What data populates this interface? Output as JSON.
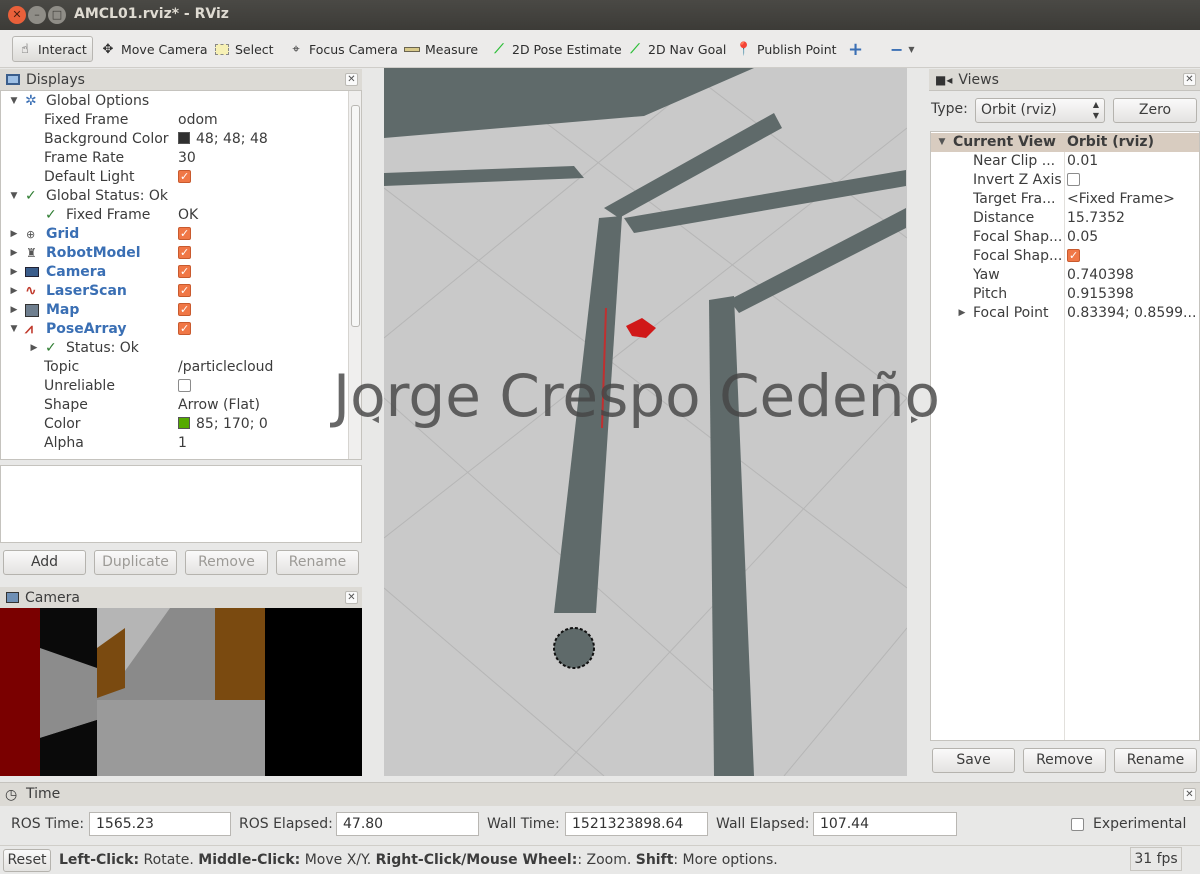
{
  "window": {
    "title": "AMCL01.rviz* - RViz"
  },
  "toolbar": {
    "tools": [
      {
        "label": "Interact",
        "icon": "hand-cursor-icon"
      },
      {
        "label": "Move Camera",
        "icon": "move-camera-icon"
      },
      {
        "label": "Select",
        "icon": "select-icon"
      },
      {
        "label": "Focus Camera",
        "icon": "crosshair-icon"
      },
      {
        "label": "Measure",
        "icon": "ruler-icon"
      },
      {
        "label": "2D Pose Estimate",
        "icon": "green-arrow-icon"
      },
      {
        "label": "2D Nav Goal",
        "icon": "green-arrow-icon"
      },
      {
        "label": "Publish Point",
        "icon": "map-pin-icon"
      }
    ]
  },
  "displays": {
    "title": "Displays",
    "rows": [
      {
        "name": "Global Options",
        "value": ""
      },
      {
        "name": "Fixed Frame",
        "value": "odom"
      },
      {
        "name": "Background Color",
        "value": "48; 48; 48",
        "swatch": "#303030"
      },
      {
        "name": "Frame Rate",
        "value": "30"
      },
      {
        "name": "Default Light",
        "value": ""
      },
      {
        "name": "Global Status: Ok",
        "value": ""
      },
      {
        "name": "Fixed Frame",
        "value": "OK"
      },
      {
        "name": "Grid",
        "value": ""
      },
      {
        "name": "RobotModel",
        "value": ""
      },
      {
        "name": "Camera",
        "value": ""
      },
      {
        "name": "LaserScan",
        "value": ""
      },
      {
        "name": "Map",
        "value": ""
      },
      {
        "name": "PoseArray",
        "value": ""
      },
      {
        "name": "Status: Ok",
        "value": ""
      },
      {
        "name": "Topic",
        "value": "/particlecloud"
      },
      {
        "name": "Unreliable",
        "value": ""
      },
      {
        "name": "Shape",
        "value": "Arrow (Flat)"
      },
      {
        "name": "Color",
        "value": "85; 170; 0",
        "swatch": "#55aa00"
      },
      {
        "name": "Alpha",
        "value": "1"
      }
    ],
    "buttons": {
      "add": "Add",
      "duplicate": "Duplicate",
      "remove": "Remove",
      "rename": "Rename"
    }
  },
  "camera_panel": {
    "title": "Camera"
  },
  "viewport": {
    "watermark": "Jorge Crespo Cedeño"
  },
  "views": {
    "title": "Views",
    "type_label": "Type:",
    "type_value": "Orbit (rviz)",
    "zero_label": "Zero",
    "header": {
      "name": "Current View",
      "value": "Orbit (rviz)"
    },
    "rows": [
      {
        "name": "Near Clip ...",
        "value": "0.01"
      },
      {
        "name": "Invert Z Axis",
        "value": ""
      },
      {
        "name": "Target Fra...",
        "value": "<Fixed Frame>"
      },
      {
        "name": "Distance",
        "value": "15.7352"
      },
      {
        "name": "Focal Shap...",
        "value": "0.05"
      },
      {
        "name": "Focal Shap...",
        "value": ""
      },
      {
        "name": "Yaw",
        "value": "0.740398"
      },
      {
        "name": "Pitch",
        "value": "0.915398"
      },
      {
        "name": "Focal Point",
        "value": "0.83394; 0.8599..."
      }
    ],
    "buttons": {
      "save": "Save",
      "remove": "Remove",
      "rename": "Rename"
    }
  },
  "time": {
    "title": "Time",
    "ros_time_label": "ROS Time:",
    "ros_time": "1565.23",
    "ros_elapsed_label": "ROS Elapsed:",
    "ros_elapsed": "47.80",
    "wall_time_label": "Wall Time:",
    "wall_time": "1521323898.64",
    "wall_elapsed_label": "Wall Elapsed:",
    "wall_elapsed": "107.44",
    "experimental_label": "Experimental"
  },
  "status": {
    "reset": "Reset",
    "hint_parts": [
      {
        "b": "Left-Click:",
        "t": " Rotate. "
      },
      {
        "b": "Middle-Click:",
        "t": " Move X/Y. "
      },
      {
        "b": "Right-Click/Mouse Wheel:",
        "t": ": Zoom. "
      },
      {
        "b": "Shift",
        "t": ": More options."
      }
    ],
    "fps": "31 fps"
  }
}
